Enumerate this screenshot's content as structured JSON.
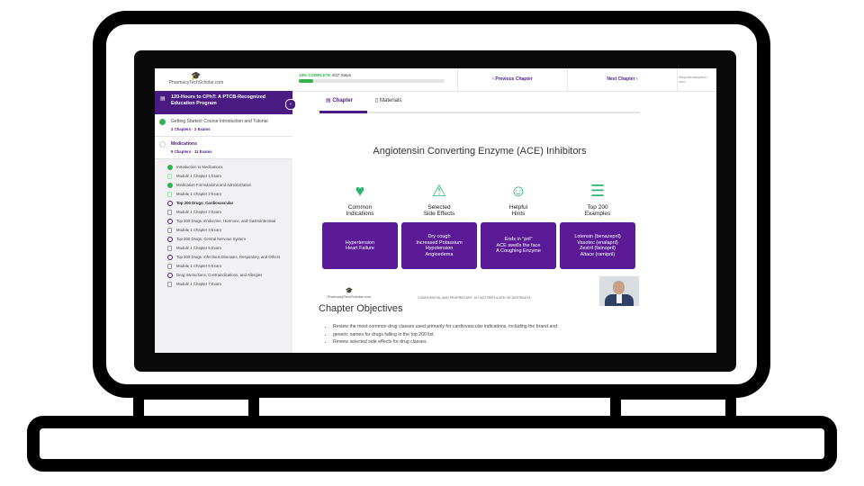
{
  "topbar": {
    "logo_site": "PharmacyTechScholar.com",
    "progress_percent": "18% COMPLETE",
    "progress_days": "4/37 Steps",
    "progress_fraction": 0.1,
    "prev_label": "‹  Previous Chapter",
    "next_label": "Next Chapter  ›",
    "url_fragment": "infopharmacytech-\ncom"
  },
  "sidebar": {
    "course_title": "120-Hours to CPhT: A PTCB-Recognized Education Program",
    "sections": [
      {
        "title": "Getting Started: Course Introduction and Tutorial",
        "meta": "2 Chapters  ·  2 Exams",
        "status": "done"
      },
      {
        "title": "Medications",
        "meta": "9 Chapters  ·  11 Exams",
        "status": "open"
      }
    ],
    "items": [
      {
        "label": "Introduction to Medications",
        "icon": "check"
      },
      {
        "label": "Module 1 Chapter 1 Exam",
        "icon": "doc-green"
      },
      {
        "label": "Medication Formulations and Administration",
        "icon": "check"
      },
      {
        "label": "Module 1 Chapter 2 Exam",
        "icon": "doc-green"
      },
      {
        "label": "Top 200 Drugs: Cardiovascular",
        "icon": "ring",
        "current": true
      },
      {
        "label": "Module 1 Chapter 3 Exam",
        "icon": "doc"
      },
      {
        "label": "Top 200 Drugs: Endocrine, Hormone, and Gastrointestinal",
        "icon": "ring"
      },
      {
        "label": "Module 1 Chapter 4 Exam",
        "icon": "doc"
      },
      {
        "label": "Top 200 Drugs: Central Nervous System",
        "icon": "ring"
      },
      {
        "label": "Module 1 Chapter 5 Exam",
        "icon": "doc"
      },
      {
        "label": "Top 200 Drugs: Infectious Diseases, Respiratory, and Others",
        "icon": "ring"
      },
      {
        "label": "Module 1 Chapter 6 Exam",
        "icon": "doc"
      },
      {
        "label": "Drug Interactions, Contraindications, and Allergies",
        "icon": "ring"
      },
      {
        "label": "Module 1 Chapter 7 Exam",
        "icon": "doc"
      }
    ]
  },
  "tabs": {
    "chapter": "Chapter",
    "materials": "Materials"
  },
  "slide": {
    "title": "Angiotensin Converting Enzyme (ACE) Inhibitors",
    "columns": [
      {
        "icon": "heart-icon",
        "glyph": "♥",
        "color": "#2bb673",
        "label1": "Common",
        "label2": "Indications",
        "lines": [
          "Hypertension",
          "Heart Failure"
        ]
      },
      {
        "icon": "warning-icon",
        "glyph": "⚠",
        "color": "#2bb673",
        "label1": "Selected",
        "label2": "Side Effects",
        "lines": [
          "Dry cough",
          "Increased Potassium",
          "Hypotension",
          "Angioedema"
        ]
      },
      {
        "icon": "hint-icon",
        "glyph": "☺",
        "color": "#2bb673",
        "label1": "Helpful",
        "label2": "Hints",
        "lines": [
          "Ends in \"pril\"",
          "ACE swells the face",
          "A Coughing Enzyme"
        ]
      },
      {
        "icon": "list-icon",
        "glyph": "☰",
        "color": "#2bb673",
        "label1": "Top 200",
        "label2": "Examples",
        "lines": [
          "Lotensin (benazepril)",
          "Vasotec (enalapril)",
          "Zestril (lisinopril)",
          "Altace (ramipril)"
        ]
      }
    ],
    "footer_site": "PharmacyTechScholar.com",
    "confidential": "CONFIDENTIAL AND PROPRIETARY. DO NOT REPLICATE OR DISTRIBUTE"
  },
  "objectives": {
    "heading": "Chapter Objectives",
    "bullets": [
      "Review the most common drug classes used primarily for cardiovascular indications, including the brand and",
      "generic names for drugs falling in the top 200 list.",
      "Review selected side effects for drug classes."
    ]
  }
}
